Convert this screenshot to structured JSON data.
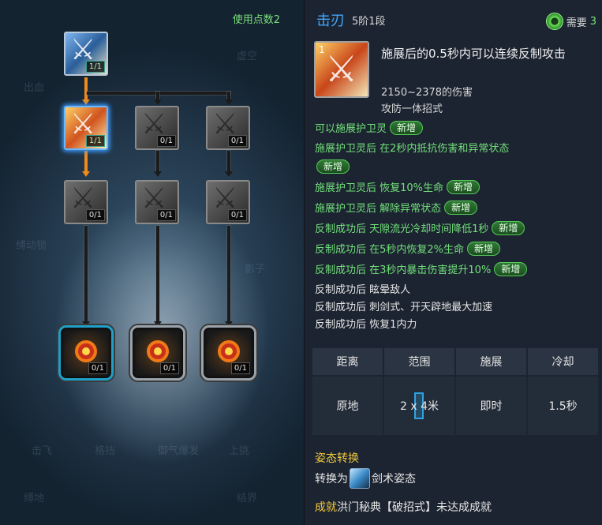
{
  "tree": {
    "points_label": "使用点数2",
    "ghost_labels": [
      "出血",
      "虚空",
      "缚动锁",
      "影子",
      "击飞",
      "格挡",
      "御气爆发",
      "上挑",
      "缚地",
      "结界"
    ],
    "row1": [
      {
        "level": "1/1",
        "state": "active"
      }
    ],
    "row2": [
      {
        "level": "1/1",
        "state": "selected"
      },
      {
        "level": "0/1",
        "state": "locked"
      },
      {
        "level": "0/1",
        "state": "locked"
      }
    ],
    "row3": [
      {
        "level": "0/1",
        "state": "locked"
      },
      {
        "level": "0/1",
        "state": "locked"
      },
      {
        "level": "0/1",
        "state": "locked"
      }
    ],
    "row4": [
      {
        "level": "0/1",
        "state": "locked"
      },
      {
        "level": "0/1",
        "state": "locked"
      },
      {
        "level": "0/1",
        "state": "locked"
      }
    ]
  },
  "detail": {
    "name": "击刃",
    "rank": "5阶1段",
    "need_label": "需要",
    "need_value": "3",
    "icon_tag": "1",
    "description": "施展后的0.5秒内可以连续反制攻击",
    "damage": "2150~2378的伤害",
    "type": "攻防一体招式",
    "new_badge": "新增",
    "effects": [
      {
        "text": "可以施展护卫灵",
        "color": "green",
        "badge": true,
        "badge_block": false
      },
      {
        "text": "施展护卫灵后 在2秒内抵抗伤害和异常状态",
        "color": "green",
        "badge": true,
        "badge_block": true
      },
      {
        "text": "施展护卫灵后 恢复10%生命",
        "color": "green",
        "badge": true,
        "badge_block": false
      },
      {
        "text": "施展护卫灵后 解除异常状态",
        "color": "green",
        "badge": true,
        "badge_block": false
      },
      {
        "text": "反制成功后 天隙流光冷却时间降低1秒",
        "color": "green",
        "badge": true,
        "badge_block": false
      },
      {
        "text": "反制成功后 在5秒内恢复2%生命",
        "color": "green",
        "badge": true,
        "badge_block": false
      },
      {
        "text": "反制成功后 在3秒内暴击伤害提升10%",
        "color": "green",
        "badge": true,
        "badge_block": false
      },
      {
        "text": "反制成功后 眩晕敌人",
        "color": "white",
        "badge": false,
        "badge_block": false
      },
      {
        "text": "反制成功后 刺剑式、开天辟地最大加速",
        "color": "white",
        "badge": false,
        "badge_block": false
      },
      {
        "text": "反制成功后 恢复1内力",
        "color": "white",
        "badge": false,
        "badge_block": false
      }
    ],
    "stats": {
      "headers": [
        "距离",
        "范围",
        "施展",
        "冷却"
      ],
      "values": [
        "原地",
        "2 x 4米",
        "即时",
        "1.5秒"
      ]
    },
    "stance_header": "姿态转换",
    "stance_prefix": "转换为",
    "stance_name": "剑术姿态",
    "achievement_key": "成就",
    "achievement_text": "洪门秘典【破招式】未达成成就"
  },
  "colors": {
    "title": "#3fa8ff",
    "effect_green": "#72e07a",
    "stance_yellow": "#f2c93c",
    "connector_active": "#f08a1c"
  },
  "icons": {
    "skill": "sword-strike-icon",
    "ultimate": "sun-seal-icon",
    "currency": "green-gem-icon",
    "stance": "sword-stance-icon"
  }
}
